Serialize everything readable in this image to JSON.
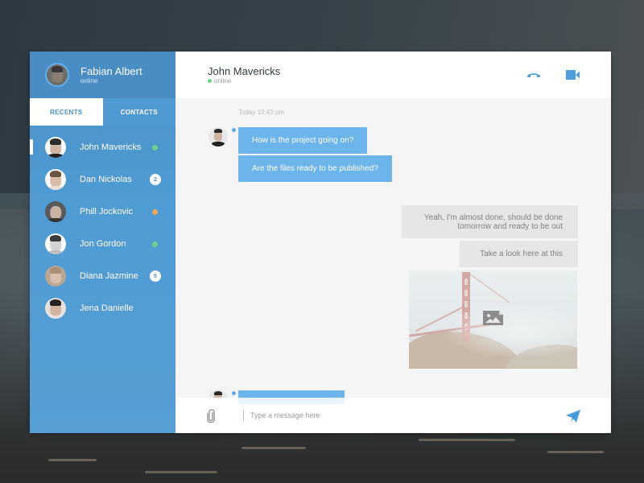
{
  "user": {
    "name": "Fabian Albert",
    "status": "online"
  },
  "tabs": [
    {
      "label": "RECENTS",
      "active": true
    },
    {
      "label": "CONTACTS",
      "active": false
    }
  ],
  "contacts": [
    {
      "name": "John Mavericks",
      "indicator": "status",
      "status_color": "#6fd08c",
      "selected": true
    },
    {
      "name": "Dan Nickolas",
      "indicator": "count",
      "count": "2"
    },
    {
      "name": "Phill Jockovic",
      "indicator": "status",
      "status_color": "#f2a455"
    },
    {
      "name": "Jon Gordon",
      "indicator": "status",
      "status_color": "#6fd08c"
    },
    {
      "name": "Diana Jazmine",
      "indicator": "count",
      "count": "5"
    },
    {
      "name": "Jena Danielle",
      "indicator": "none"
    }
  ],
  "chat": {
    "contact_name": "John Mavericks",
    "contact_status": "online",
    "status_color": "#6fd08c",
    "actions": [
      {
        "icon": "phone-icon",
        "label": "Voice call"
      },
      {
        "icon": "video-camera-icon",
        "label": "Video call"
      }
    ],
    "timestamp": "Today 10:43 pm",
    "messages": [
      {
        "direction": "incoming",
        "text": "How is the project going on?"
      },
      {
        "direction": "incoming",
        "text": "Are the files ready to be published?"
      },
      {
        "direction": "outgoing",
        "text": "Yeah, I'm almost done, should be done tomorrow and ready to be out"
      },
      {
        "direction": "outgoing",
        "text": "Take a look here at this"
      },
      {
        "direction": "outgoing",
        "type": "image",
        "icon": "image-icon"
      },
      {
        "direction": "incoming",
        "text": ""
      }
    ]
  },
  "composer": {
    "placeholder": "Type a message here",
    "value": ""
  },
  "colors": {
    "accent": "#4a90c8",
    "incoming_bubble": "#6cb5ec",
    "outgoing_bubble": "#e6e6e6",
    "online": "#6fd08c",
    "away": "#f2a455"
  }
}
